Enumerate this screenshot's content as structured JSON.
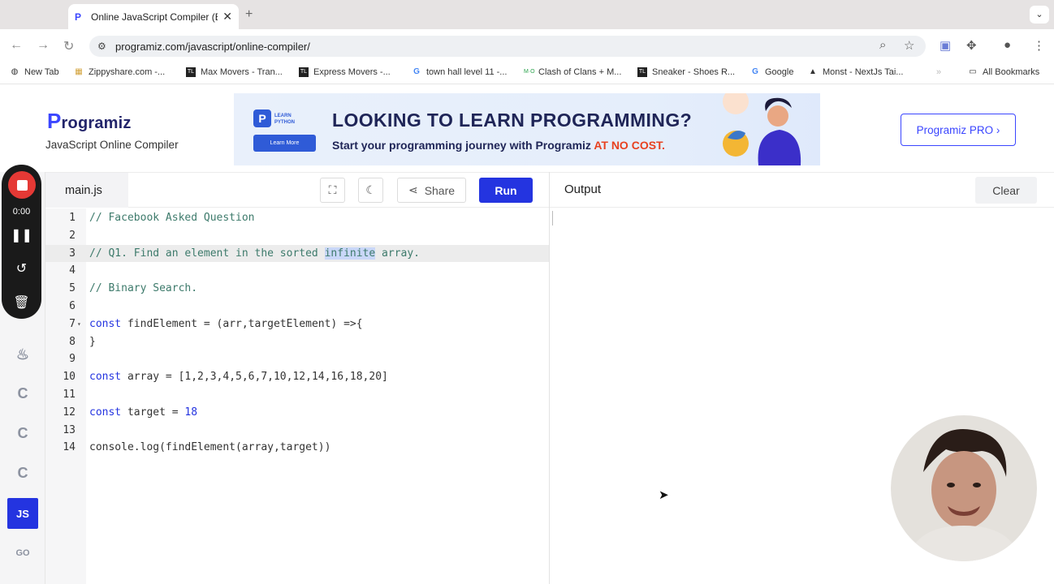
{
  "browser": {
    "active_tab_title": "Online JavaScript Compiler (E",
    "url": "programiz.com/javascript/online-compiler/",
    "bookmarks": [
      {
        "label": "New Tab",
        "icon": "globe-icon"
      },
      {
        "label": "Zippyshare.com -...",
        "icon": "zippyshare-icon"
      },
      {
        "label": "Max Movers - Tran...",
        "icon": "tl-icon"
      },
      {
        "label": "Express Movers -...",
        "icon": "tl-icon"
      },
      {
        "label": "town hall level 11 -...",
        "icon": "google-icon"
      },
      {
        "label": "Clash of Clans + M...",
        "icon": "mio-icon"
      },
      {
        "label": "Sneaker - Shoes R...",
        "icon": "tl-icon"
      },
      {
        "label": "Google",
        "icon": "google-icon"
      },
      {
        "label": "Monst - NextJs Tai...",
        "icon": "triangle-icon"
      }
    ],
    "all_bookmarks_label": "All Bookmarks"
  },
  "header": {
    "logo_text": "rogramiz",
    "logo_letter": "P",
    "subtitle": "JavaScript Online Compiler",
    "pro_button": "Programiz PRO ›"
  },
  "banner": {
    "badge_letter": "P",
    "badge_text_1": "LEARN",
    "badge_text_2": "PYTHON",
    "button_label": "Learn More",
    "headline": "LOOKING TO LEARN PROGRAMMING?",
    "subline": "Start your programming journey with Programiz ",
    "subline_highlight": "AT NO COST."
  },
  "recorder": {
    "time": "0:00"
  },
  "editor": {
    "file_name": "main.js",
    "share_label": "Share",
    "run_label": "Run",
    "lines": [
      {
        "n": "1",
        "text": "// Facebook Asked Question"
      },
      {
        "n": "2",
        "text": ""
      },
      {
        "n": "3",
        "pre": "// Q1. Find an element in the sorted ",
        "selected": "infinite",
        "post": " array."
      },
      {
        "n": "4",
        "text": ""
      },
      {
        "n": "5",
        "text": "// Binary Search."
      },
      {
        "n": "6",
        "text": ""
      },
      {
        "n": "7",
        "kw": "const",
        "rest": " findElement = (arr,targetElement) =>{"
      },
      {
        "n": "8",
        "text": "}"
      },
      {
        "n": "9",
        "text": ""
      },
      {
        "n": "10",
        "kw": "const",
        "rest": " array = [1,2,3,4,5,6,7,10,12,14,16,18,20]"
      },
      {
        "n": "11",
        "text": ""
      },
      {
        "n": "12",
        "kw": "const",
        "rest": " target = ",
        "num": "18"
      },
      {
        "n": "13",
        "text": ""
      },
      {
        "n": "14",
        "text": "console.log(findElement(array,target))"
      }
    ]
  },
  "output": {
    "title": "Output",
    "clear_label": "Clear"
  },
  "rail": {
    "js_label": "JS",
    "go_label": "GO",
    "c_label": "C"
  },
  "colors": {
    "brand": "#2434e0",
    "accent_orange": "#e8411f",
    "record_red": "#e53935"
  }
}
